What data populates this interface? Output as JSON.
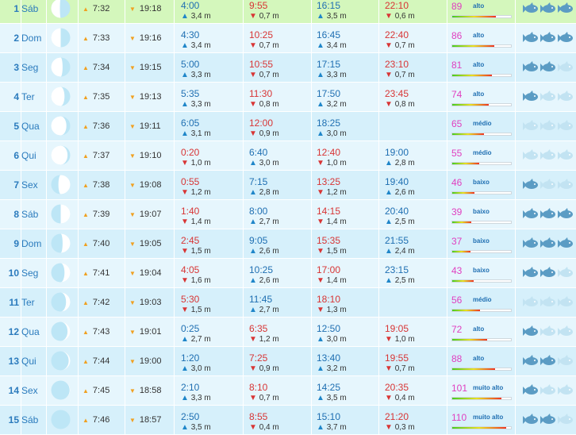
{
  "rows": [
    {
      "day": "1",
      "name": "Sáb",
      "illum": 0.46,
      "side": "L",
      "rise": "7:32",
      "set": "19:18",
      "t1": {
        "type": "high",
        "time": "4:00",
        "height": "3,4 m"
      },
      "t2": {
        "type": "low",
        "time": "9:55",
        "height": "0,7 m"
      },
      "t3": {
        "type": "high",
        "time": "16:15",
        "height": "3,5 m"
      },
      "t4": {
        "type": "low",
        "time": "22:10",
        "height": "0,6 m"
      },
      "coef": "89",
      "level": "alto",
      "coef_value": 89,
      "fish": 3
    },
    {
      "day": "2",
      "name": "Dom",
      "illum": 0.5,
      "side": "L",
      "rise": "7:33",
      "set": "19:16",
      "t1": {
        "type": "high",
        "time": "4:30",
        "height": "3,4 m"
      },
      "t2": {
        "type": "low",
        "time": "10:25",
        "height": "0,7 m"
      },
      "t3": {
        "type": "high",
        "time": "16:45",
        "height": "3,4 m"
      },
      "t4": {
        "type": "low",
        "time": "22:40",
        "height": "0,7 m"
      },
      "coef": "86",
      "level": "alto",
      "coef_value": 86,
      "fish": 3
    },
    {
      "day": "3",
      "name": "Seg",
      "illum": 0.6,
      "side": "L",
      "rise": "7:34",
      "set": "19:15",
      "t1": {
        "type": "high",
        "time": "5:00",
        "height": "3,3 m"
      },
      "t2": {
        "type": "low",
        "time": "10:55",
        "height": "0,7 m"
      },
      "t3": {
        "type": "high",
        "time": "17:15",
        "height": "3,3 m"
      },
      "t4": {
        "type": "low",
        "time": "23:10",
        "height": "0,7 m"
      },
      "coef": "81",
      "level": "alto",
      "coef_value": 81,
      "fish": 2
    },
    {
      "day": "4",
      "name": "Ter",
      "illum": 0.7,
      "side": "L",
      "rise": "7:35",
      "set": "19:13",
      "t1": {
        "type": "high",
        "time": "5:35",
        "height": "3,3 m"
      },
      "t2": {
        "type": "low",
        "time": "11:30",
        "height": "0,8 m"
      },
      "t3": {
        "type": "high",
        "time": "17:50",
        "height": "3,2 m"
      },
      "t4": {
        "type": "low",
        "time": "23:45",
        "height": "0,8 m"
      },
      "coef": "74",
      "level": "alto",
      "coef_value": 74,
      "fish": 1
    },
    {
      "day": "5",
      "name": "Qua",
      "illum": 0.8,
      "side": "L",
      "rise": "7:36",
      "set": "19:11",
      "t1": {
        "type": "high",
        "time": "6:05",
        "height": "3,1 m"
      },
      "t2": {
        "type": "low",
        "time": "12:00",
        "height": "0,9 m"
      },
      "t3": {
        "type": "high",
        "time": "18:25",
        "height": "3,0 m"
      },
      "t4": null,
      "coef": "65",
      "level": "médio",
      "coef_value": 65,
      "fish": 0
    },
    {
      "day": "6",
      "name": "Qui",
      "illum": 0.86,
      "side": "L",
      "rise": "7:37",
      "set": "19:10",
      "t1": {
        "type": "low",
        "time": "0:20",
        "height": "1,0 m"
      },
      "t2": {
        "type": "high",
        "time": "6:40",
        "height": "3,0 m"
      },
      "t3": {
        "type": "low",
        "time": "12:40",
        "height": "1,0 m"
      },
      "t4": {
        "type": "high",
        "time": "19:00",
        "height": "2,8 m"
      },
      "coef": "55",
      "level": "médio",
      "coef_value": 55,
      "fish": 0
    },
    {
      "day": "7",
      "name": "Sex",
      "illum": 0.62,
      "side": "R",
      "rise": "7:38",
      "set": "19:08",
      "t1": {
        "type": "low",
        "time": "0:55",
        "height": "1,2 m"
      },
      "t2": {
        "type": "high",
        "time": "7:15",
        "height": "2,8 m"
      },
      "t3": {
        "type": "low",
        "time": "13:25",
        "height": "1,2 m"
      },
      "t4": {
        "type": "high",
        "time": "19:40",
        "height": "2,6 m"
      },
      "coef": "46",
      "level": "baixo",
      "coef_value": 46,
      "fish": 1
    },
    {
      "day": "8",
      "name": "Sáb",
      "illum": 0.5,
      "side": "R",
      "rise": "7:39",
      "set": "19:07",
      "t1": {
        "type": "low",
        "time": "1:40",
        "height": "1,4 m"
      },
      "t2": {
        "type": "high",
        "time": "8:00",
        "height": "2,7 m"
      },
      "t3": {
        "type": "low",
        "time": "14:15",
        "height": "1,4 m"
      },
      "t4": {
        "type": "high",
        "time": "20:40",
        "height": "2,5 m"
      },
      "coef": "39",
      "level": "baixo",
      "coef_value": 39,
      "fish": 3
    },
    {
      "day": "9",
      "name": "Dom",
      "illum": 0.4,
      "side": "R",
      "rise": "7:40",
      "set": "19:05",
      "t1": {
        "type": "low",
        "time": "2:45",
        "height": "1,5 m"
      },
      "t2": {
        "type": "high",
        "time": "9:05",
        "height": "2,6 m"
      },
      "t3": {
        "type": "low",
        "time": "15:35",
        "height": "1,5 m"
      },
      "t4": {
        "type": "high",
        "time": "21:55",
        "height": "2,4 m"
      },
      "coef": "37",
      "level": "baixo",
      "coef_value": 37,
      "fish": 3
    },
    {
      "day": "10",
      "name": "Seg",
      "illum": 0.3,
      "side": "R",
      "rise": "7:41",
      "set": "19:04",
      "t1": {
        "type": "low",
        "time": "4:05",
        "height": "1,6 m"
      },
      "t2": {
        "type": "high",
        "time": "10:25",
        "height": "2,6 m"
      },
      "t3": {
        "type": "low",
        "time": "17:00",
        "height": "1,4 m"
      },
      "t4": {
        "type": "high",
        "time": "23:15",
        "height": "2,5 m"
      },
      "coef": "43",
      "level": "baixo",
      "coef_value": 43,
      "fish": 2
    },
    {
      "day": "11",
      "name": "Ter",
      "illum": 0.22,
      "side": "R",
      "rise": "7:42",
      "set": "19:03",
      "t1": {
        "type": "low",
        "time": "5:30",
        "height": "1,5 m"
      },
      "t2": {
        "type": "high",
        "time": "11:45",
        "height": "2,7 m"
      },
      "t3": {
        "type": "low",
        "time": "18:10",
        "height": "1,3 m"
      },
      "t4": null,
      "coef": "56",
      "level": "médio",
      "coef_value": 56,
      "fish": 0
    },
    {
      "day": "12",
      "name": "Qua",
      "illum": 0.14,
      "side": "R",
      "rise": "7:43",
      "set": "19:01",
      "t1": {
        "type": "high",
        "time": "0:25",
        "height": "2,7 m"
      },
      "t2": {
        "type": "low",
        "time": "6:35",
        "height": "1,2 m"
      },
      "t3": {
        "type": "high",
        "time": "12:50",
        "height": "3,0 m"
      },
      "t4": {
        "type": "low",
        "time": "19:05",
        "height": "1,0 m"
      },
      "coef": "72",
      "level": "alto",
      "coef_value": 72,
      "fish": 1
    },
    {
      "day": "13",
      "name": "Qui",
      "illum": 0.08,
      "side": "R",
      "rise": "7:44",
      "set": "19:00",
      "t1": {
        "type": "high",
        "time": "1:20",
        "height": "3,0 m"
      },
      "t2": {
        "type": "low",
        "time": "7:25",
        "height": "0,9 m"
      },
      "t3": {
        "type": "high",
        "time": "13:40",
        "height": "3,2 m"
      },
      "t4": {
        "type": "low",
        "time": "19:55",
        "height": "0,7 m"
      },
      "coef": "88",
      "level": "alto",
      "coef_value": 88,
      "fish": 2
    },
    {
      "day": "14",
      "name": "Sex",
      "illum": 0.03,
      "side": "R",
      "rise": "7:45",
      "set": "18:58",
      "t1": {
        "type": "high",
        "time": "2:10",
        "height": "3,3 m"
      },
      "t2": {
        "type": "low",
        "time": "8:10",
        "height": "0,7 m"
      },
      "t3": {
        "type": "high",
        "time": "14:25",
        "height": "3,5 m"
      },
      "t4": {
        "type": "low",
        "time": "20:35",
        "height": "0,4 m"
      },
      "coef": "101",
      "level": "muito alto",
      "coef_value": 101,
      "fish": 1
    },
    {
      "day": "15",
      "name": "Sáb",
      "illum": 0,
      "side": "R",
      "rise": "7:46",
      "set": "18:57",
      "t1": {
        "type": "high",
        "time": "2:50",
        "height": "3,5 m"
      },
      "t2": {
        "type": "low",
        "time": "8:55",
        "height": "0,4 m"
      },
      "t3": {
        "type": "high",
        "time": "15:10",
        "height": "3,7 m"
      },
      "t4": {
        "type": "low",
        "time": "21:20",
        "height": "0,3 m"
      },
      "coef": "110",
      "level": "muito alto",
      "coef_value": 110,
      "fish": 2
    }
  ],
  "colors": {
    "high": "#1f6fb2",
    "low": "#d83535",
    "coef": "#e040c0",
    "fish_on": "#5b9cc4",
    "fish_off": "#c2e3f2",
    "moon_lit": "#ffffff",
    "moon_dark": "#bde6f6"
  },
  "icons": {
    "sunrise": "triangle-up-icon",
    "sunset": "triangle-down-icon",
    "high_tide": "triangle-up-icon",
    "low_tide": "triangle-down-icon",
    "fish": "fish-icon",
    "moon": "moon-phase-icon"
  }
}
